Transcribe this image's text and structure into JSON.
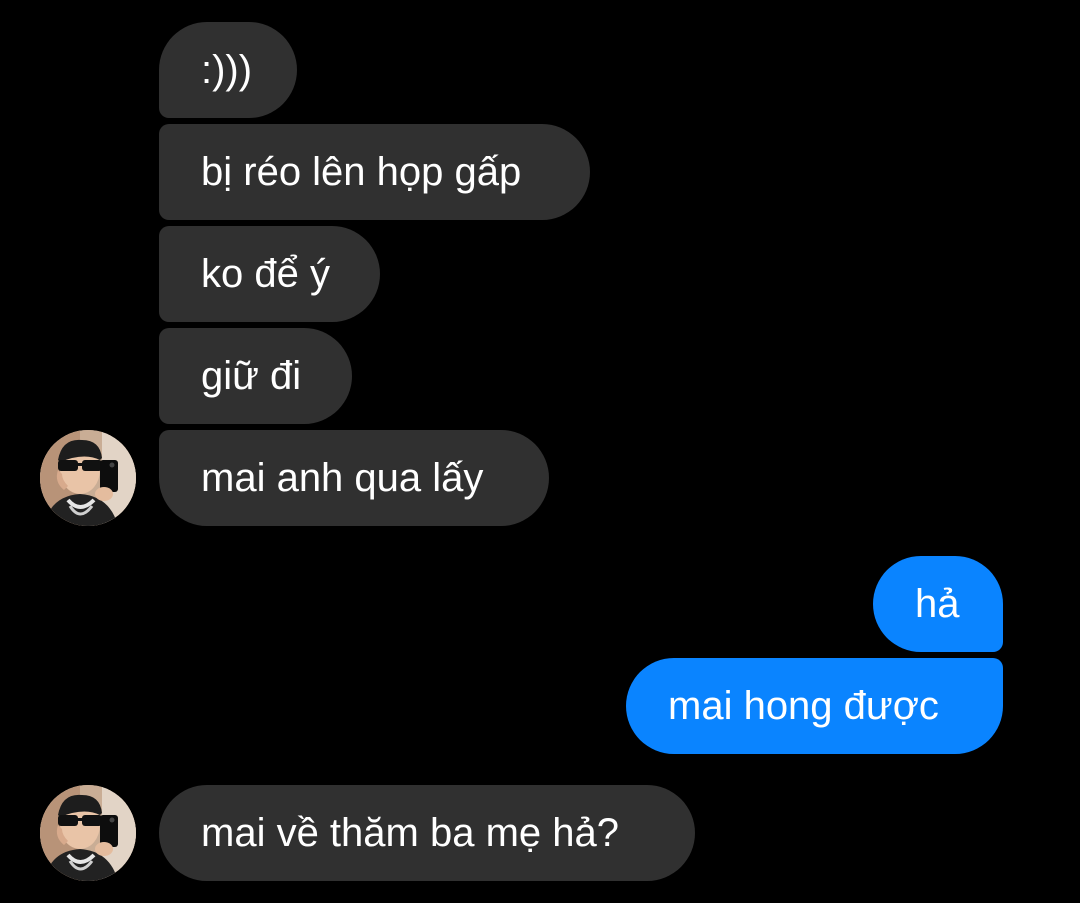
{
  "colors": {
    "background": "#000000",
    "incoming_bubble": "#303030",
    "outgoing_bubble": "#0A84FF",
    "text": "#ffffff"
  },
  "messages": [
    {
      "side": "incoming",
      "text": ":)))"
    },
    {
      "side": "incoming",
      "text": "bị réo lên họp gấp"
    },
    {
      "side": "incoming",
      "text": "ko để ý"
    },
    {
      "side": "incoming",
      "text": "giữ đi"
    },
    {
      "side": "incoming",
      "text": "mai anh qua lấy"
    },
    {
      "side": "outgoing",
      "text": "hả"
    },
    {
      "side": "outgoing",
      "text": "mai hong được"
    },
    {
      "side": "incoming",
      "text": "mai về thăm ba mẹ hả?"
    }
  ],
  "contact": {
    "avatar_icon": "avatar-photo-icon"
  }
}
